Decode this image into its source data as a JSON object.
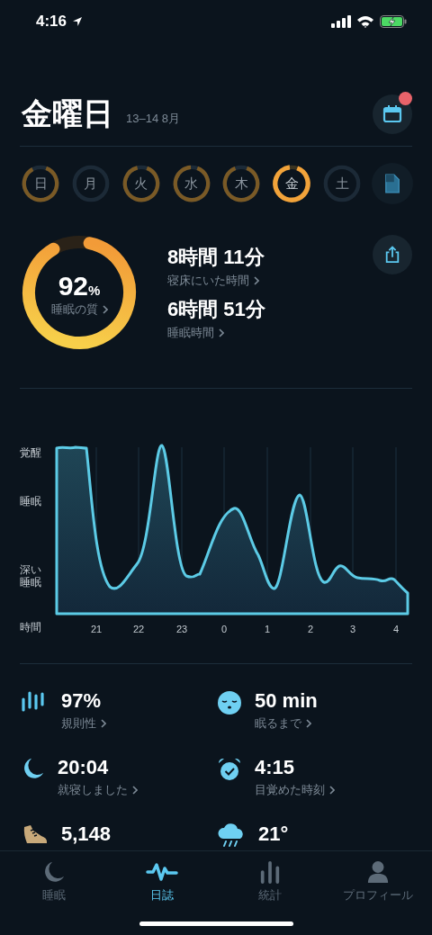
{
  "status_bar": {
    "time": "4:16"
  },
  "header": {
    "title": "金曜日",
    "date_range": "13–14 8月",
    "calendar_notification": true
  },
  "days": [
    {
      "label": "日",
      "selected": false
    },
    {
      "label": "月",
      "selected": false
    },
    {
      "label": "火",
      "selected": false
    },
    {
      "label": "水",
      "selected": false
    },
    {
      "label": "木",
      "selected": false
    },
    {
      "label": "金",
      "selected": true
    },
    {
      "label": "土",
      "selected": false
    }
  ],
  "summary": {
    "quality": {
      "value": "92",
      "unit": "%",
      "label": "睡眠の質"
    },
    "metrics": [
      {
        "value": "8時間 11分",
        "label": "寝床にいた時間"
      },
      {
        "value": "6時間 51分",
        "label": "睡眠時間"
      }
    ]
  },
  "chart": {
    "y_labels": [
      "覚醒",
      "睡眠",
      "深い睡眠"
    ],
    "x_title": "時間",
    "x_labels": [
      "21",
      "22",
      "23",
      "0",
      "1",
      "2",
      "3",
      "4"
    ]
  },
  "stats": [
    {
      "value": "97%",
      "label": "規則性"
    },
    {
      "value": "50 min",
      "label": "眠るまで"
    },
    {
      "value": "20:04",
      "label": "就寝しました"
    },
    {
      "value": "4:15",
      "label": "目覚めた時刻"
    },
    {
      "value": "5,148"
    },
    {
      "value": "21°"
    }
  ],
  "tabs": [
    {
      "label": "睡眠",
      "selected": false
    },
    {
      "label": "日誌",
      "selected": true
    },
    {
      "label": "統計",
      "selected": false
    },
    {
      "label": "プロフィール",
      "selected": false
    }
  ]
}
